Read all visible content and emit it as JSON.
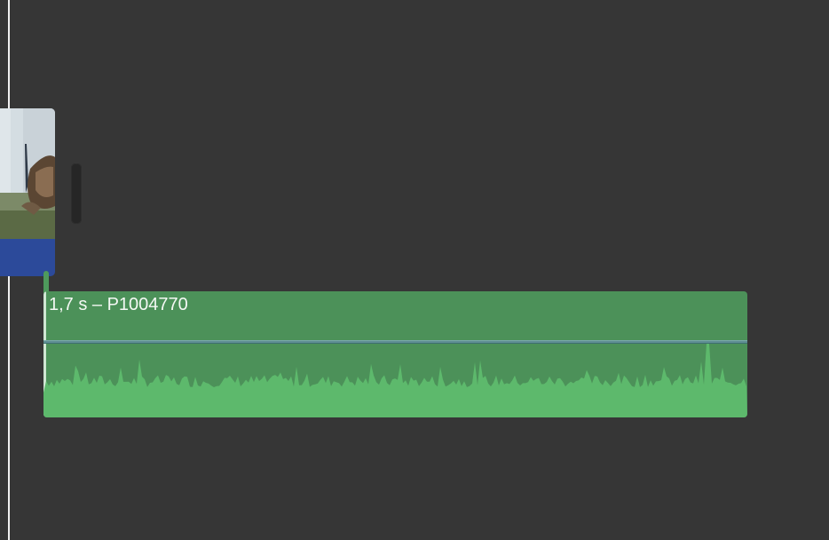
{
  "audio_clip": {
    "title": "1,7 s – P1004770",
    "color": "#4c9159",
    "waveform_color": "#5db96c"
  },
  "video_clip": {
    "audio_bar_color": "#2c4a9a"
  },
  "playhead": {
    "color": "#f2f2f2"
  }
}
